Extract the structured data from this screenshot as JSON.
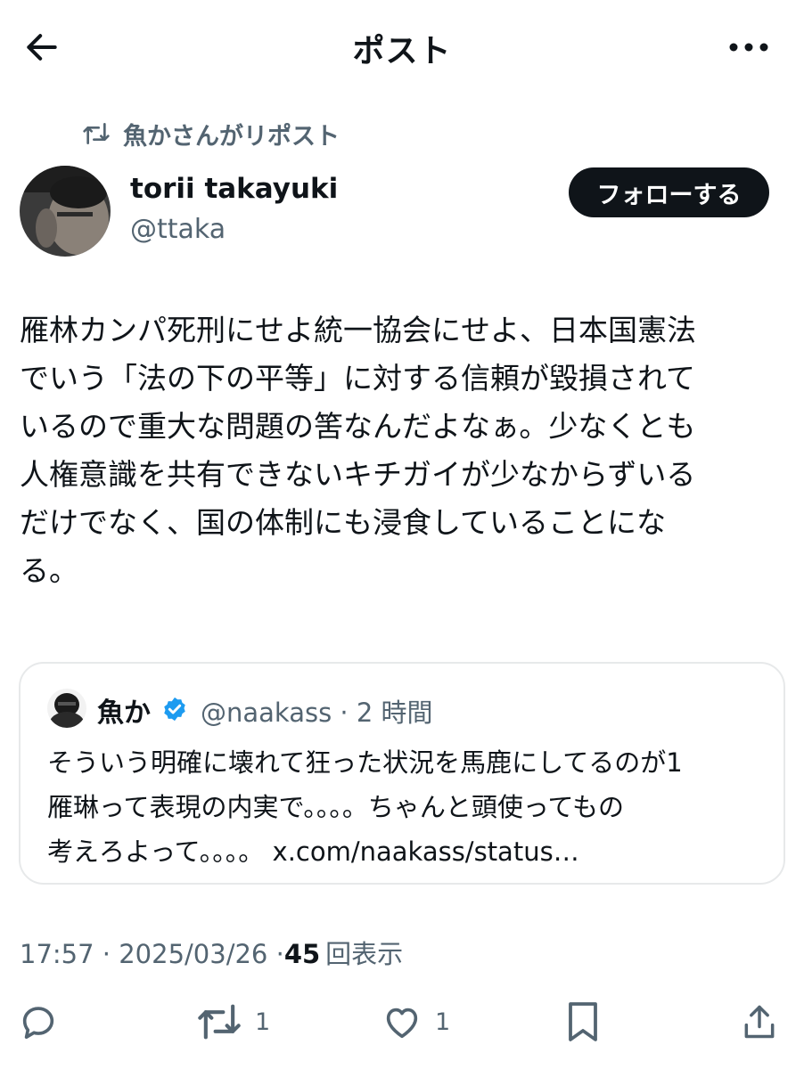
{
  "header": {
    "title": "ポスト",
    "back_icon": "arrow-left-icon",
    "more_icon": "more-horizontal-icon"
  },
  "repost_context": {
    "icon": "repost-icon",
    "text": "魚かさんがリポスト"
  },
  "author": {
    "name": "torii takayuki",
    "handle": "@ttaka",
    "follow_label": "フォローする"
  },
  "post": {
    "lines": [
      "雁林カンパ死刑にせよ統一協会にせよ、日本国憲法",
      "でいう「法の下の平等」に対する信頼が毀損されて",
      "いるので重大な問題の筈なんだよなぁ。少なくとも",
      "人権意識を共有できないキチガイが少なからずいる",
      "だけでなく、国の体制にも浸食していることにな",
      "る。"
    ]
  },
  "quoted_post": {
    "name": "魚か",
    "verified_badge": "verified-badge-icon",
    "handle_time": "@naakass · 2 時間",
    "lines": [
      "そういう明確に壊れて狂った状況を馬鹿にしてるのが1",
      "雁琳って表現の内実で。。。。ちゃんと頭使ってもの",
      "考えろよって。。。。 x.com/naakass/status…"
    ]
  },
  "meta": {
    "time_date": "17:57 · 2025/03/26 · ",
    "views_count": "45",
    "views_label": "回表示"
  },
  "actions": {
    "reply_icon": "reply-icon",
    "repost_icon": "repost-icon",
    "repost_count": "1",
    "like_icon": "heart-icon",
    "like_count": "1",
    "bookmark_icon": "bookmark-icon",
    "share_icon": "share-icon"
  },
  "colors": {
    "text_primary": "#0f1419",
    "text_secondary": "#536471",
    "border": "#e7e9ea",
    "verified": "#1d9bf0",
    "button_bg": "#0f1419"
  }
}
